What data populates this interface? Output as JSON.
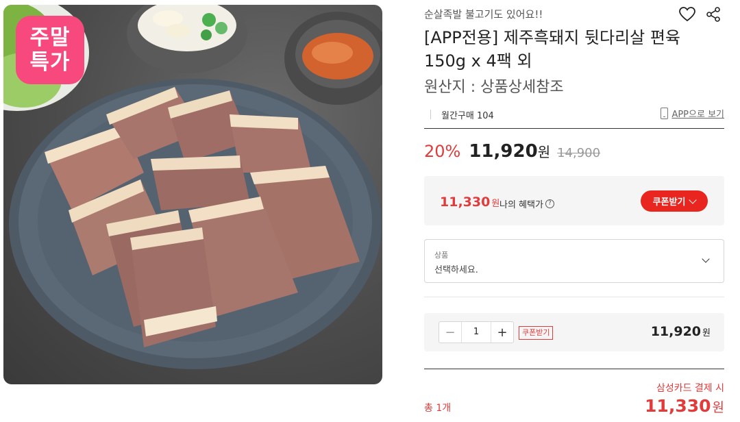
{
  "badge": {
    "line1": "주말",
    "line2": "특가",
    "color": "#f7497e"
  },
  "product": {
    "subtitle": "순살족발 불고기도 있어요!!",
    "title": "[APP전용] 제주흑돼지 뒷다리살 편육 150g x 4팩 외",
    "origin": "원산지 : 상품상세참조",
    "monthly_purchase": "월간구매 104",
    "app_view_label": "APP으로 보기",
    "icons": {
      "wishlist": "heart-icon",
      "share": "share-icon",
      "app": "phone-icon"
    }
  },
  "price": {
    "discount_rate": "20%",
    "sale_price": "11,920",
    "won": "원",
    "original_price": "14,900"
  },
  "benefit": {
    "price": "11,330",
    "won": "원",
    "label": "나의 혜택가",
    "help": "?",
    "coupon_button": "쿠폰받기"
  },
  "option_select": {
    "label": "상품",
    "placeholder": "선택하세요."
  },
  "quantity": {
    "minus": "−",
    "value": "1",
    "plus": "+",
    "coupon_tag": "쿠폰받기",
    "line_price": "11,920",
    "won": "원"
  },
  "total": {
    "card_note": "삼성카드 결제 시",
    "count": "총 1개",
    "price": "11,330",
    "won": "원"
  },
  "colors": {
    "accent_red": "#e23b3b",
    "button_red": "#e8251e",
    "panel_bg": "#f5f5f5"
  }
}
